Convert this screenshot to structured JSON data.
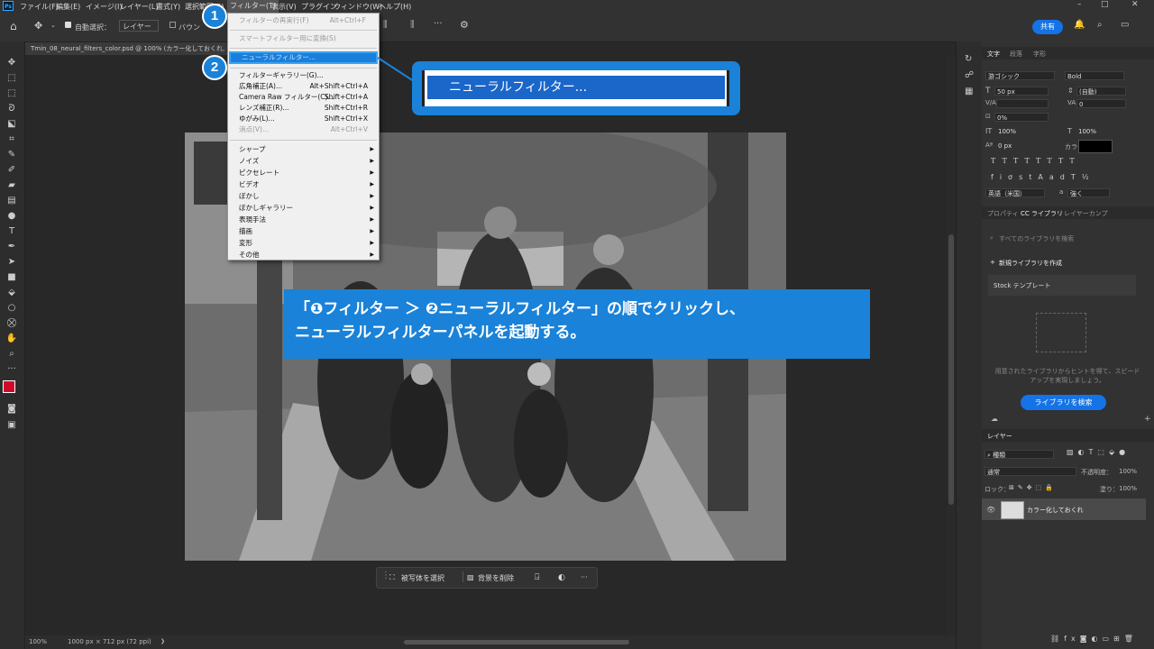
{
  "app": {
    "logo_text": "Ps"
  },
  "menubar": {
    "items": [
      "ファイル(F)",
      "編集(E)",
      "イメージ(I)",
      "レイヤー(L)",
      "書式(Y)",
      "選択範囲(S)",
      "フィルター(T)",
      "表示(V)",
      "プラグイン",
      "ウィンドウ(W)",
      "ヘルプ(H)"
    ],
    "window_controls": [
      "–",
      "□",
      "✕"
    ]
  },
  "options_bar": {
    "auto_select_label": "自動選択：",
    "auto_select_value": "レイヤー",
    "bounding_label": "バウン",
    "share_label": "共有"
  },
  "document": {
    "tab_title": "Tmin_08_neural_filters_color.psd @ 100% (カラー化しておくれ, RGB/8)"
  },
  "filter_menu": {
    "items": [
      {
        "label": "フィルターの再実行(F)",
        "shortcut": "Alt+Ctrl+F",
        "disabled": true
      },
      {
        "sep": true
      },
      {
        "label": "スマートフィルター用に変換(S)",
        "shortcut": "",
        "disabled": true
      },
      {
        "sep": true
      },
      {
        "label": "ニューラルフィルター...",
        "shortcut": "",
        "highlight": true
      },
      {
        "sep": true
      },
      {
        "label": "フィルターギャラリー(G)...",
        "shortcut": ""
      },
      {
        "label": "広角補正(A)...",
        "shortcut": "Alt+Shift+Ctrl+A"
      },
      {
        "label": "Camera Raw フィルター(C)...",
        "shortcut": "Shift+Ctrl+A"
      },
      {
        "label": "レンズ補正(R)...",
        "shortcut": "Shift+Ctrl+R"
      },
      {
        "label": "ゆがみ(L)...",
        "shortcut": "Shift+Ctrl+X"
      },
      {
        "label": "消点(V)...",
        "shortcut": "Alt+Ctrl+V",
        "disabled": true
      },
      {
        "sep": true
      },
      {
        "label": "シャープ",
        "submenu": true
      },
      {
        "label": "ノイズ",
        "submenu": true
      },
      {
        "label": "ピクセレート",
        "submenu": true
      },
      {
        "label": "ビデオ",
        "submenu": true
      },
      {
        "label": "ぼかし",
        "submenu": true
      },
      {
        "label": "ぼかしギャラリー",
        "submenu": true
      },
      {
        "label": "表現手法",
        "submenu": true
      },
      {
        "label": "描画",
        "submenu": true
      },
      {
        "label": "変形",
        "submenu": true
      },
      {
        "label": "その他",
        "submenu": true
      }
    ]
  },
  "callouts": {
    "badge1": "1",
    "badge2": "2",
    "zoom_label": "ニューラルフィルター...",
    "caption_line1": "「❶フィルター ＞ ❷ニューラルフィルター」の順でクリックし、",
    "caption_line2": "ニューラルフィルターパネルを起動する。"
  },
  "context_bar": {
    "select_subject": "被写体を選択",
    "remove_bg": "背景を削除",
    "more": "···"
  },
  "status_bar": {
    "zoom": "100%",
    "doc_size": "1000 px × 712 px (72 ppi)"
  },
  "char_panel": {
    "tabs": [
      "文字",
      "段落",
      "字形"
    ],
    "font_family": "游ゴシック",
    "font_style": "Bold",
    "font_size": "50 px",
    "leading": "(自動)",
    "kerning": "",
    "tracking": "0",
    "tsume": "0%",
    "vscale": "100%",
    "hscale": "100%",
    "baseline": "0 px",
    "color_label": "カラー：",
    "color": "#000000",
    "lang": "英語（米国）",
    "aa_label": "a",
    "aa_value": "強く"
  },
  "library_panel": {
    "tabs": [
      "プロパティ",
      "CC ライブラリ",
      "レイヤーカンプ"
    ],
    "search_placeholder": "すべてのライブラリを検索",
    "new_library": "新規ライブラリを作成",
    "stock_item": "Stock テンプレート",
    "hint": "用意されたライブラリからヒントを得て、スピードアップを実現しましょう。",
    "search_button": "ライブラリを検索"
  },
  "layers_panel": {
    "tab": "レイヤー",
    "filter_kind": "種類",
    "blend_mode": "通常",
    "opacity_label": "不透明度：",
    "opacity": "100%",
    "lock_label": "ロック：",
    "fill_label": "塗り：",
    "fill": "100%",
    "layer_name": "カラー化しておくれ"
  }
}
